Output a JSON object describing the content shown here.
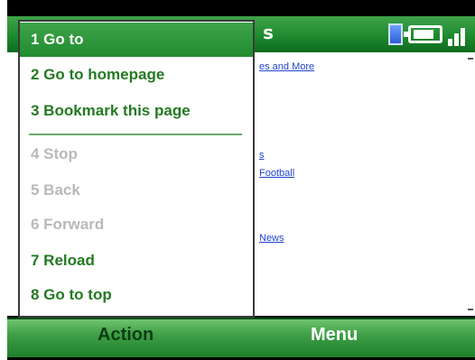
{
  "titlebar": {
    "title_fragment": "s"
  },
  "page": {
    "links": [
      "es and More",
      "s",
      "Football",
      "News"
    ]
  },
  "menu": {
    "items": [
      {
        "label": "1 Go to",
        "state": "selected"
      },
      {
        "label": "2 Go to homepage",
        "state": "enabled"
      },
      {
        "label": "3 Bookmark this page",
        "state": "enabled"
      },
      {
        "label": "4 Stop",
        "state": "disabled"
      },
      {
        "label": "5 Back",
        "state": "disabled"
      },
      {
        "label": "6 Forward",
        "state": "disabled"
      },
      {
        "label": "7 Reload",
        "state": "enabled"
      },
      {
        "label": "8 Go to top",
        "state": "enabled"
      }
    ]
  },
  "softkeys": {
    "left": "Action",
    "right": "Menu"
  },
  "colors": {
    "accent_green": "#237a21",
    "bar_green": "#1e8a2e",
    "link_blue": "#2244cc",
    "disabled_gray": "#b9b9b9"
  },
  "icons": {
    "status": [
      "document-icon",
      "battery-icon",
      "signal-icon"
    ]
  }
}
